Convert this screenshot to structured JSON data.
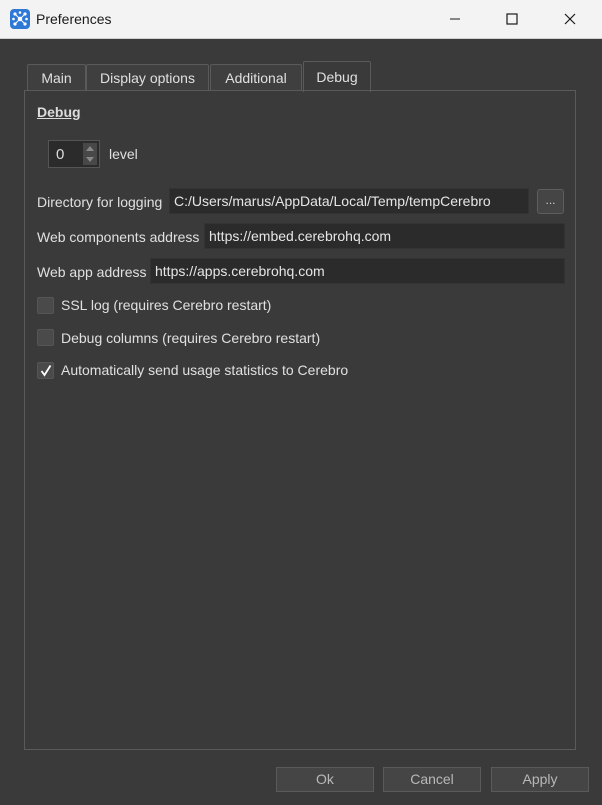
{
  "window": {
    "title": "Preferences",
    "controls": [
      "minimize-icon",
      "maximize-icon",
      "close-icon"
    ]
  },
  "tabs": [
    {
      "label": "Main",
      "active": false
    },
    {
      "label": "Display options",
      "active": false
    },
    {
      "label": "Additional",
      "active": false
    },
    {
      "label": "Debug",
      "active": true
    }
  ],
  "debug": {
    "section_title": "Debug",
    "level_value": "0",
    "level_label": "level",
    "logging_dir_label": "Directory for logging",
    "logging_dir_value": "C:/Users/marus/AppData/Local/Temp/tempCerebro",
    "browse_label": "...",
    "web_components_label": "Web components address",
    "web_components_value": "https://embed.cerebrohq.com",
    "web_app_label": "Web app address",
    "web_app_value": "https://apps.cerebrohq.com",
    "checkboxes": [
      {
        "label": "SSL log (requires Cerebro restart)",
        "checked": false
      },
      {
        "label": "Debug columns (requires Cerebro restart)",
        "checked": false
      },
      {
        "label": "Automatically send usage statistics to Cerebro",
        "checked": true
      }
    ]
  },
  "buttons": {
    "ok": "Ok",
    "cancel": "Cancel",
    "apply": "Apply"
  },
  "colors": {
    "background": "#3a3a3a",
    "titlebar": "#f3f3f3",
    "field": "#2b2b2b",
    "accent": "#2f78d6"
  }
}
